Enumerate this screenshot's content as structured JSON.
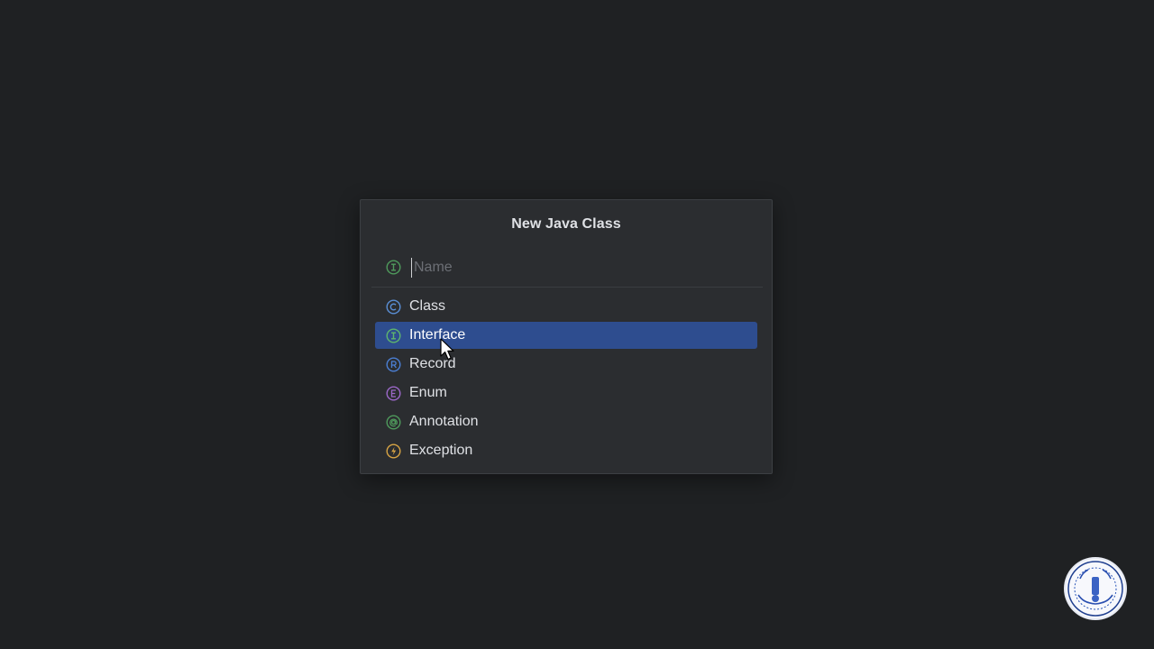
{
  "dialog": {
    "title": "New Java Class",
    "name_field": {
      "value": "",
      "placeholder": "Name",
      "icon": "interface-icon"
    },
    "kinds": [
      {
        "label": "Class",
        "icon": "class-icon",
        "letter": "C",
        "color": "#5a8fd6",
        "selected": false
      },
      {
        "label": "Interface",
        "icon": "interface-icon",
        "letter": "I",
        "color": "#4f9a5c",
        "selected": true
      },
      {
        "label": "Record",
        "icon": "record-icon",
        "letter": "R",
        "color": "#4b7fd4",
        "selected": false
      },
      {
        "label": "Enum",
        "icon": "enum-icon",
        "letter": "E",
        "color": "#9c68c9",
        "selected": false
      },
      {
        "label": "Annotation",
        "icon": "annotation-icon",
        "letter": "@",
        "color": "#4f9a5c",
        "selected": false
      },
      {
        "label": "Exception",
        "icon": "exception-icon",
        "letter": "⚡",
        "color": "#d9a544",
        "selected": false
      }
    ]
  },
  "colors": {
    "background": "#1f2123",
    "dialog_bg": "#2b2d30",
    "selection": "#2e4d8f",
    "text": "#dfe1e5",
    "placeholder": "#6c6f75"
  },
  "overlay": {
    "badge_icon": "channel-logo-icon"
  }
}
